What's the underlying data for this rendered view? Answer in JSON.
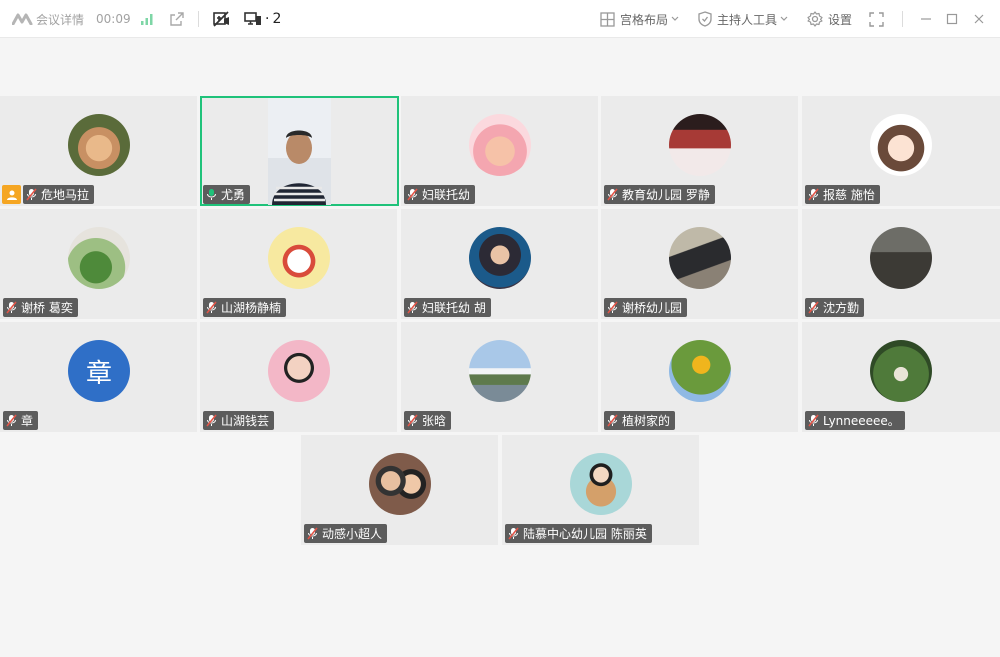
{
  "toolbar": {
    "meeting_details": "会议详情",
    "timer": "00:09",
    "screen_count": "2",
    "layout_label": "宫格布局",
    "host_tools_label": "主持人工具",
    "settings_label": "设置",
    "colors": {
      "accent_green": "#1fc27a",
      "host_badge": "#f5a623",
      "muted_red": "#e25548"
    }
  },
  "participants": [
    {
      "name": "危地马拉",
      "host": true
    },
    {
      "name": "尤勇",
      "speaking": true,
      "video": true
    },
    {
      "name": "妇联托幼"
    },
    {
      "name": "教育幼儿园 罗静"
    },
    {
      "name": "报慈 施怡"
    },
    {
      "name": "谢桥 葛奕"
    },
    {
      "name": "山湖杨静楠"
    },
    {
      "name": "妇联托幼 胡"
    },
    {
      "name": "谢桥幼儿园"
    },
    {
      "name": "沈方勤"
    },
    {
      "name": "章",
      "avatar_text": "章"
    },
    {
      "name": "山湖钱芸"
    },
    {
      "name": "张晗"
    },
    {
      "name": "植树家的"
    },
    {
      "name": "Lynneeeee。"
    },
    {
      "name": "动感小超人"
    },
    {
      "name": "陆慕中心幼儿园 陈丽英"
    }
  ]
}
